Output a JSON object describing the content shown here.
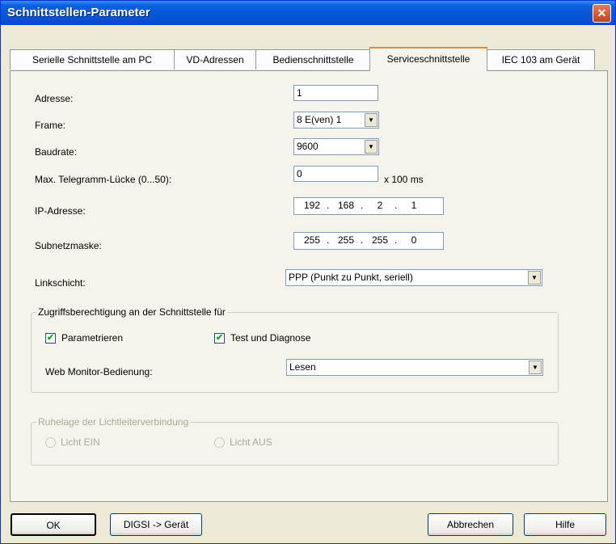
{
  "window": {
    "title": "Schnittstellen-Parameter"
  },
  "tabs": [
    {
      "label": "Serielle Schnittstelle am PC"
    },
    {
      "label": "VD-Adressen"
    },
    {
      "label": "Bedienschnittstelle"
    },
    {
      "label": "Serviceschnittstelle",
      "active": true
    },
    {
      "label": "IEC 103 am Gerät"
    }
  ],
  "form": {
    "adresse": {
      "label": "Adresse:",
      "value": "1"
    },
    "frame": {
      "label": "Frame:",
      "value": "8 E(ven) 1"
    },
    "baudrate": {
      "label": "Baudrate:",
      "value": "9600"
    },
    "gap": {
      "label": "Max. Telegramm-Lücke (0...50):",
      "value": "0",
      "unit": "x 100 ms"
    },
    "ip": {
      "label": "IP-Adresse:",
      "octets": [
        "192",
        "168",
        "2",
        "1"
      ]
    },
    "subnet": {
      "label": "Subnetzmaske:",
      "octets": [
        "255",
        "255",
        "255",
        "0"
      ]
    },
    "link": {
      "label": "Linkschicht:",
      "value": "PPP (Punkt zu Punkt, seriell)"
    }
  },
  "access_group": {
    "legend": "Zugriffsberechtigung an der Schnittstelle für",
    "parametrieren": {
      "label": "Parametrieren",
      "checked": true
    },
    "test": {
      "label": "Test und Diagnose",
      "checked": true
    },
    "web_label": "Web Monitor-Bedienung:",
    "web_value": "Lesen"
  },
  "fiber_group": {
    "legend": "Ruhelage der Lichtleiterverbindung",
    "on_label": "Licht EIN",
    "off_label": "Licht AUS"
  },
  "buttons": {
    "ok": "OK",
    "digsi": "DIGSI -> Gerät",
    "cancel": "Abbrechen",
    "help": "Hilfe"
  },
  "glyphs": {
    "check": "✔",
    "arrow": "▼",
    "close": "✕",
    "dot": "."
  }
}
